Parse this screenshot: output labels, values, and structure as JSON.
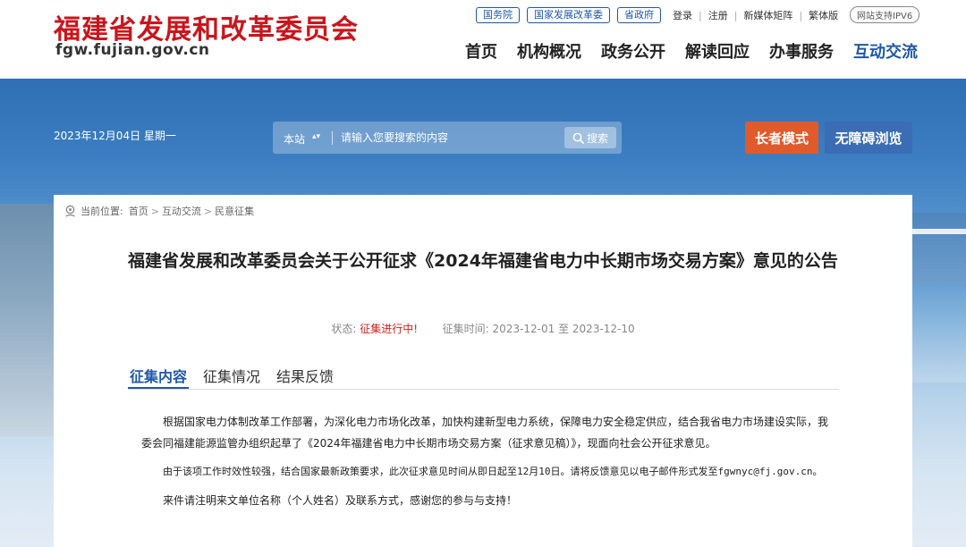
{
  "header": {
    "logo_text": "福建省发展和改革委员会",
    "logo_url": "fgw.fujian.gov.cn",
    "external_links": [
      "国务院",
      "国家发展改革委",
      "省政府"
    ],
    "top_links": [
      "登录",
      "注册",
      "新媒体矩阵",
      "繁体版"
    ],
    "ipv6_badge": "网站支持IPV6",
    "nav": [
      "首页",
      "机构概况",
      "政务公开",
      "解读回应",
      "办事服务",
      "互动交流"
    ],
    "active_nav": "互动交流"
  },
  "banner": {
    "date": "2023年12月04日 星期一",
    "search": {
      "scope": "本站",
      "placeholder": "请输入您要搜索的内容",
      "button": "搜索"
    },
    "elder_mode": "长者模式",
    "accessibility": "无障碍浏览"
  },
  "content": {
    "breadcrumb": {
      "prefix": "当前位置:",
      "items": [
        "首页",
        "互动交流",
        "民意征集"
      ]
    },
    "title": "福建省发展和改革委员会关于公开征求《2024年福建省电力中长期市场交易方案》意见的公告",
    "meta": {
      "status_label": "状态:",
      "status_value": "征集进行中!",
      "time_label": "征集时间:",
      "time_value": "2023-12-01 至 2023-12-10"
    },
    "tabs": [
      "征集内容",
      "征集情况",
      "结果反馈"
    ],
    "active_tab": "征集内容",
    "paragraphs": [
      "根据国家电力体制改革工作部署，为深化电力市场化改革，加快构建新型电力系统，保障电力安全稳定供应，结合我省电力市场建设实际，我委会同福建能源监管办组织起草了《2024年福建省电力中长期市场交易方案（征求意见稿）》，现面向社会公开征求意见。",
      "由于该项工作时效性较强，结合国家最新政策要求，此次征求意见时间从即日起至12月10日。请将反馈意见以电子邮件形式发至fgwnyc@fj.gov.cn。",
      "来件请注明来文单位名称（个人姓名）及联系方式，感谢您的参与与支持！"
    ]
  },
  "colors": {
    "brand_red": "#c8161d",
    "nav_blue": "#1f58a7",
    "elder_orange": "#e05a2c",
    "accessibility_blue": "#3a6db4",
    "status_red": "#d0231e"
  }
}
